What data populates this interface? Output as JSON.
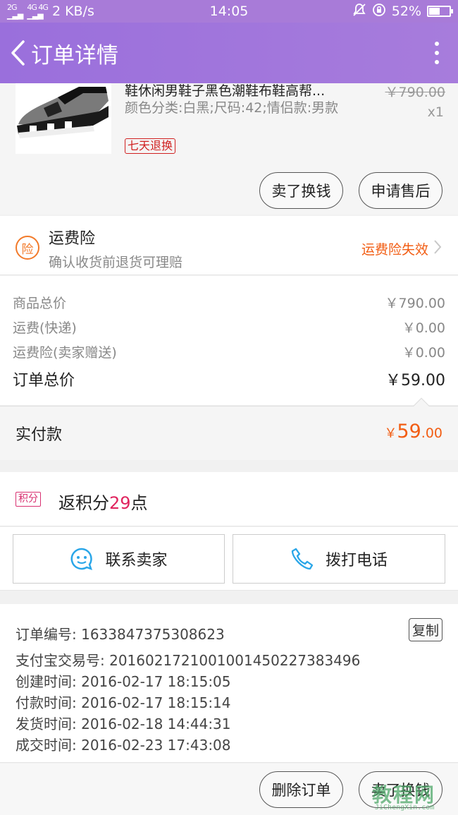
{
  "status_bar": {
    "network": "2 KB/s",
    "time": "14:05",
    "battery_percent": "52%",
    "battery_level": 0.52
  },
  "nav": {
    "title": "订单详情"
  },
  "product": {
    "name": "鞋休闲男鞋子黑色潮鞋布鞋高帮...",
    "spec": "颜色分类:白黑;尺码:42;情侣款:男款",
    "tag": "七天退换",
    "original_price": "￥790.00",
    "quantity": "x1"
  },
  "product_actions": {
    "sell_label": "卖了换钱",
    "after_sale_label": "申请售后"
  },
  "insurance": {
    "badge": "险",
    "title": "运费险",
    "subtitle": "确认收货前退货可理赔",
    "status": "运费险失效"
  },
  "summary": {
    "rows": [
      {
        "label": "商品总价",
        "value": "￥790.00"
      },
      {
        "label": "运费(快递)",
        "value": "￥0.00"
      },
      {
        "label": "运费险(卖家赠送)",
        "value": "￥0.00"
      }
    ],
    "total_label": "订单总价",
    "total_value": "￥59.00"
  },
  "paid": {
    "label": "实付款",
    "symbol": "￥",
    "integer": "59",
    "decimal": ".00"
  },
  "points": {
    "badge": "积分",
    "prefix": "返积分",
    "number": "29",
    "suffix": "点"
  },
  "contact": {
    "seller_label": "联系卖家",
    "call_label": "拨打电话"
  },
  "order_info": {
    "order_no": "订单编号: 1633847375308623",
    "alipay_no": "支付宝交易号: 2016021721001001450227383496",
    "created": "创建时间: 2016-02-17 18:15:05",
    "paid": "付款时间: 2016-02-17 18:15:14",
    "shipped": "发货时间: 2016-02-18 14:44:31",
    "completed": "成交时间: 2016-02-23 17:43:08",
    "copy_label": "复制"
  },
  "bottom_actions": {
    "delete_label": "删除订单",
    "sell_label": "卖了换钱"
  },
  "watermark": {
    "text": "教程网",
    "url": "JiChengXin.com"
  },
  "colors": {
    "brand": "#a77cdc",
    "accent_orange": "#f25d13",
    "points_pink": "#e0245e",
    "tag_red": "#d02020",
    "icon_blue": "#2aa6e8"
  }
}
